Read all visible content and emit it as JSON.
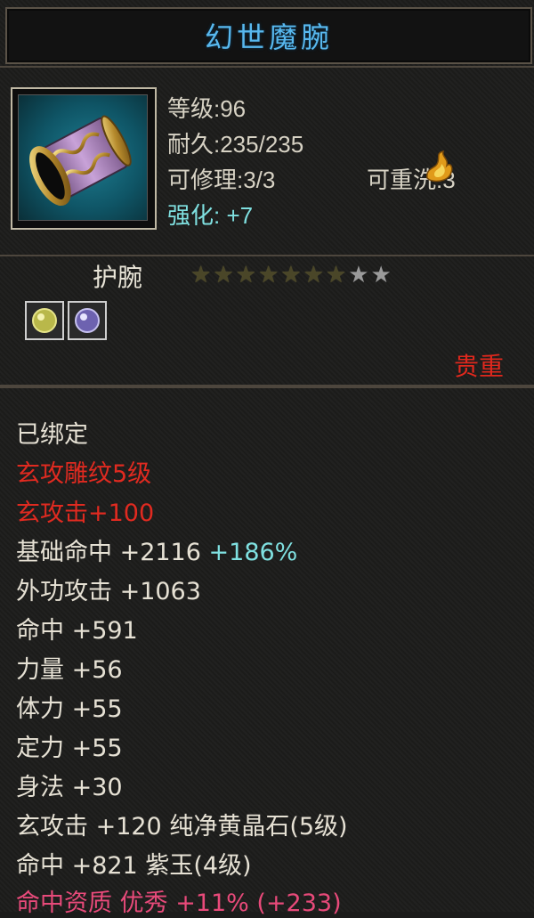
{
  "item": {
    "name": "幻世魔腕",
    "level": "等级:96",
    "durability": "耐久:235/235",
    "repair": "可修理:3/3",
    "rewash": "可重洗:3",
    "enhance": "强化: +7",
    "type": "护腕",
    "stars": {
      "filled": 7,
      "total": 9
    },
    "rarity": "贵重"
  },
  "attributes": {
    "bound": "已绑定",
    "xuan_engrave": "玄攻雕纹5级",
    "xuan_hit": "玄攻击+100",
    "base_hit_label": "基础命中 +2116",
    "base_hit_pct": "+186%",
    "outer_attack": "外功攻击 +1063",
    "hit": "命中 +591",
    "strength": "力量 +56",
    "stamina": "体力 +55",
    "focus": "定力 +55",
    "agility": "身法 +30",
    "gem1": "玄攻击 +120 纯净黄晶石(5级)",
    "gem2": "命中 +821 紫玉(4级)",
    "aptitude_label": "命中资质 优秀",
    "aptitude_value": "+11% (+233)"
  },
  "colors": {
    "title": "#58b8ee",
    "enhance": "#7fe0e0",
    "rarity": "#e0281d",
    "engrave": "#e02a20",
    "aptitude": "#e84a7a"
  },
  "icons": [
    "bracer-item-icon",
    "flame-badge-icon",
    "star-icon",
    "yellow-gem-icon",
    "purple-gem-icon"
  ]
}
